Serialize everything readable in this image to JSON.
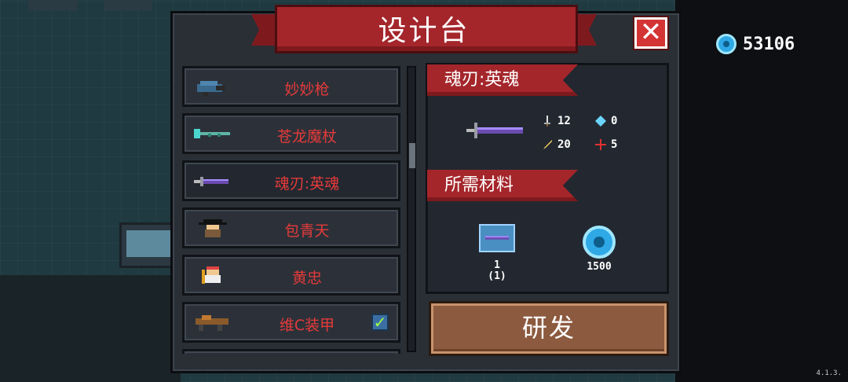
{
  "title": "设计台",
  "currency": {
    "value": "53106",
    "icon": "gem-icon"
  },
  "list": {
    "items": [
      {
        "name": "妙妙枪",
        "icon": "gun-icon",
        "selected": false,
        "checked": false
      },
      {
        "name": "苍龙魔杖",
        "icon": "staff-icon",
        "selected": false,
        "checked": false
      },
      {
        "name": "魂刃:英魂",
        "icon": "sword-icon",
        "selected": true,
        "checked": false
      },
      {
        "name": "包青天",
        "icon": "character-icon",
        "selected": false,
        "checked": false
      },
      {
        "name": "黄忠",
        "icon": "character-icon",
        "selected": false,
        "checked": false
      },
      {
        "name": "维C装甲",
        "icon": "armor-icon",
        "selected": false,
        "checked": true
      }
    ]
  },
  "detail": {
    "item_name": "魂刃:英魂",
    "stats": {
      "attack": "12",
      "energy": "0",
      "speed": "20",
      "crit": "5"
    }
  },
  "materials": {
    "header": "所需材料",
    "items": [
      {
        "icon": "sword-blueprint-icon",
        "count_line1": "1",
        "count_line2": "(1)"
      },
      {
        "icon": "gem-icon",
        "count_line1": "1500"
      }
    ]
  },
  "research_button": "研发",
  "close_label": "✕",
  "version": "4.1.3.",
  "colors": {
    "banner": "#a4262b",
    "list_text": "#e53a3a",
    "button": "#8c5a3f",
    "gem": "#2fa8e6"
  }
}
